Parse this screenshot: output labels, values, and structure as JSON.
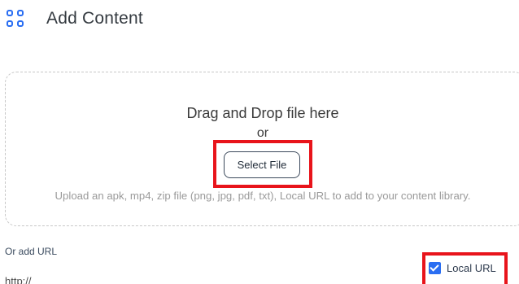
{
  "header": {
    "icon": "grid-icon",
    "title": "Add Content"
  },
  "dropzone": {
    "title": "Drag and Drop file here",
    "or_text": "or",
    "select_file_label": "Select File",
    "hint": "Upload an apk, mp4, zip file (png, jpg, pdf, txt), Local URL to add to your content library."
  },
  "url_section": {
    "label": "Or add URL",
    "placeholder": "http://",
    "local_url_label": "Local URL",
    "local_url_checked": true
  },
  "colors": {
    "accent": "#2a6ef2",
    "highlight": "#e8141b"
  }
}
